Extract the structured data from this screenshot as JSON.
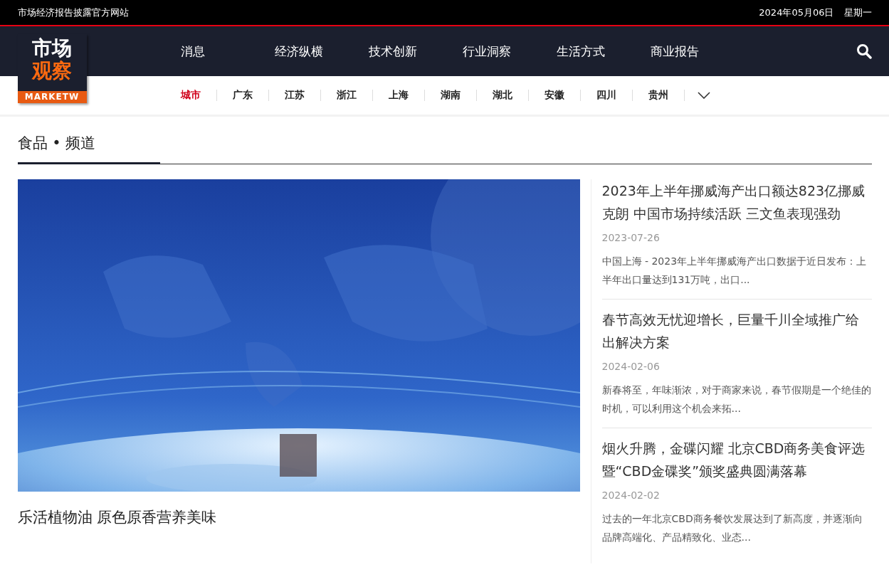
{
  "top_bar": {
    "site_tagline": "市场经济报告披露官方网站",
    "date": "2024年05月06日",
    "weekday": "星期一"
  },
  "logo": {
    "line_1": "市场",
    "line_2": "观察",
    "wordmark": "MARKETW"
  },
  "main_nav": [
    "消息",
    "经济纵横",
    "技术创新",
    "行业洞察",
    "生活方式",
    "商业报告"
  ],
  "city_nav": [
    {
      "label": "城市",
      "selected": true
    },
    {
      "label": "广东",
      "selected": false
    },
    {
      "label": "江苏",
      "selected": false
    },
    {
      "label": "浙江",
      "selected": false
    },
    {
      "label": "上海",
      "selected": false
    },
    {
      "label": "湖南",
      "selected": false
    },
    {
      "label": "湖北",
      "selected": false
    },
    {
      "label": "安徽",
      "selected": false
    },
    {
      "label": "四川",
      "selected": false
    },
    {
      "label": "贵州",
      "selected": false
    }
  ],
  "section": {
    "title": "食品 • 频道"
  },
  "featured": {
    "kind": "picture",
    "title": "乐活植物油 原色原香营养美味"
  },
  "articles": [
    {
      "title": "2023年上半年挪威海产出口额达823亿挪威克朗 中国市场持续活跃 三文鱼表现强劲",
      "date": "2023-07-26",
      "summary": "中国上海 - 2023年上半年挪威海产出口数据于近日发布：上半年出口量达到131万吨，出口..."
    },
    {
      "title": "春节高效无忧迎增长，巨量千川全域推广给出解决方案",
      "date": "2024-02-06",
      "summary": "新春将至，年味渐浓，对于商家来说，春节假期是一个绝佳的时机，可以利用这个机会来拓..."
    },
    {
      "title": "烟火升腾，金碟闪耀 北京CBD商务美食评选暨“CBD金碟奖”颁奖盛典圆满落幕",
      "date": "2024-02-02",
      "summary": "过去的一年北京CBD商务餐饮发展达到了新高度，并逐渐向品牌高端化、产品精致化、业态..."
    }
  ]
}
